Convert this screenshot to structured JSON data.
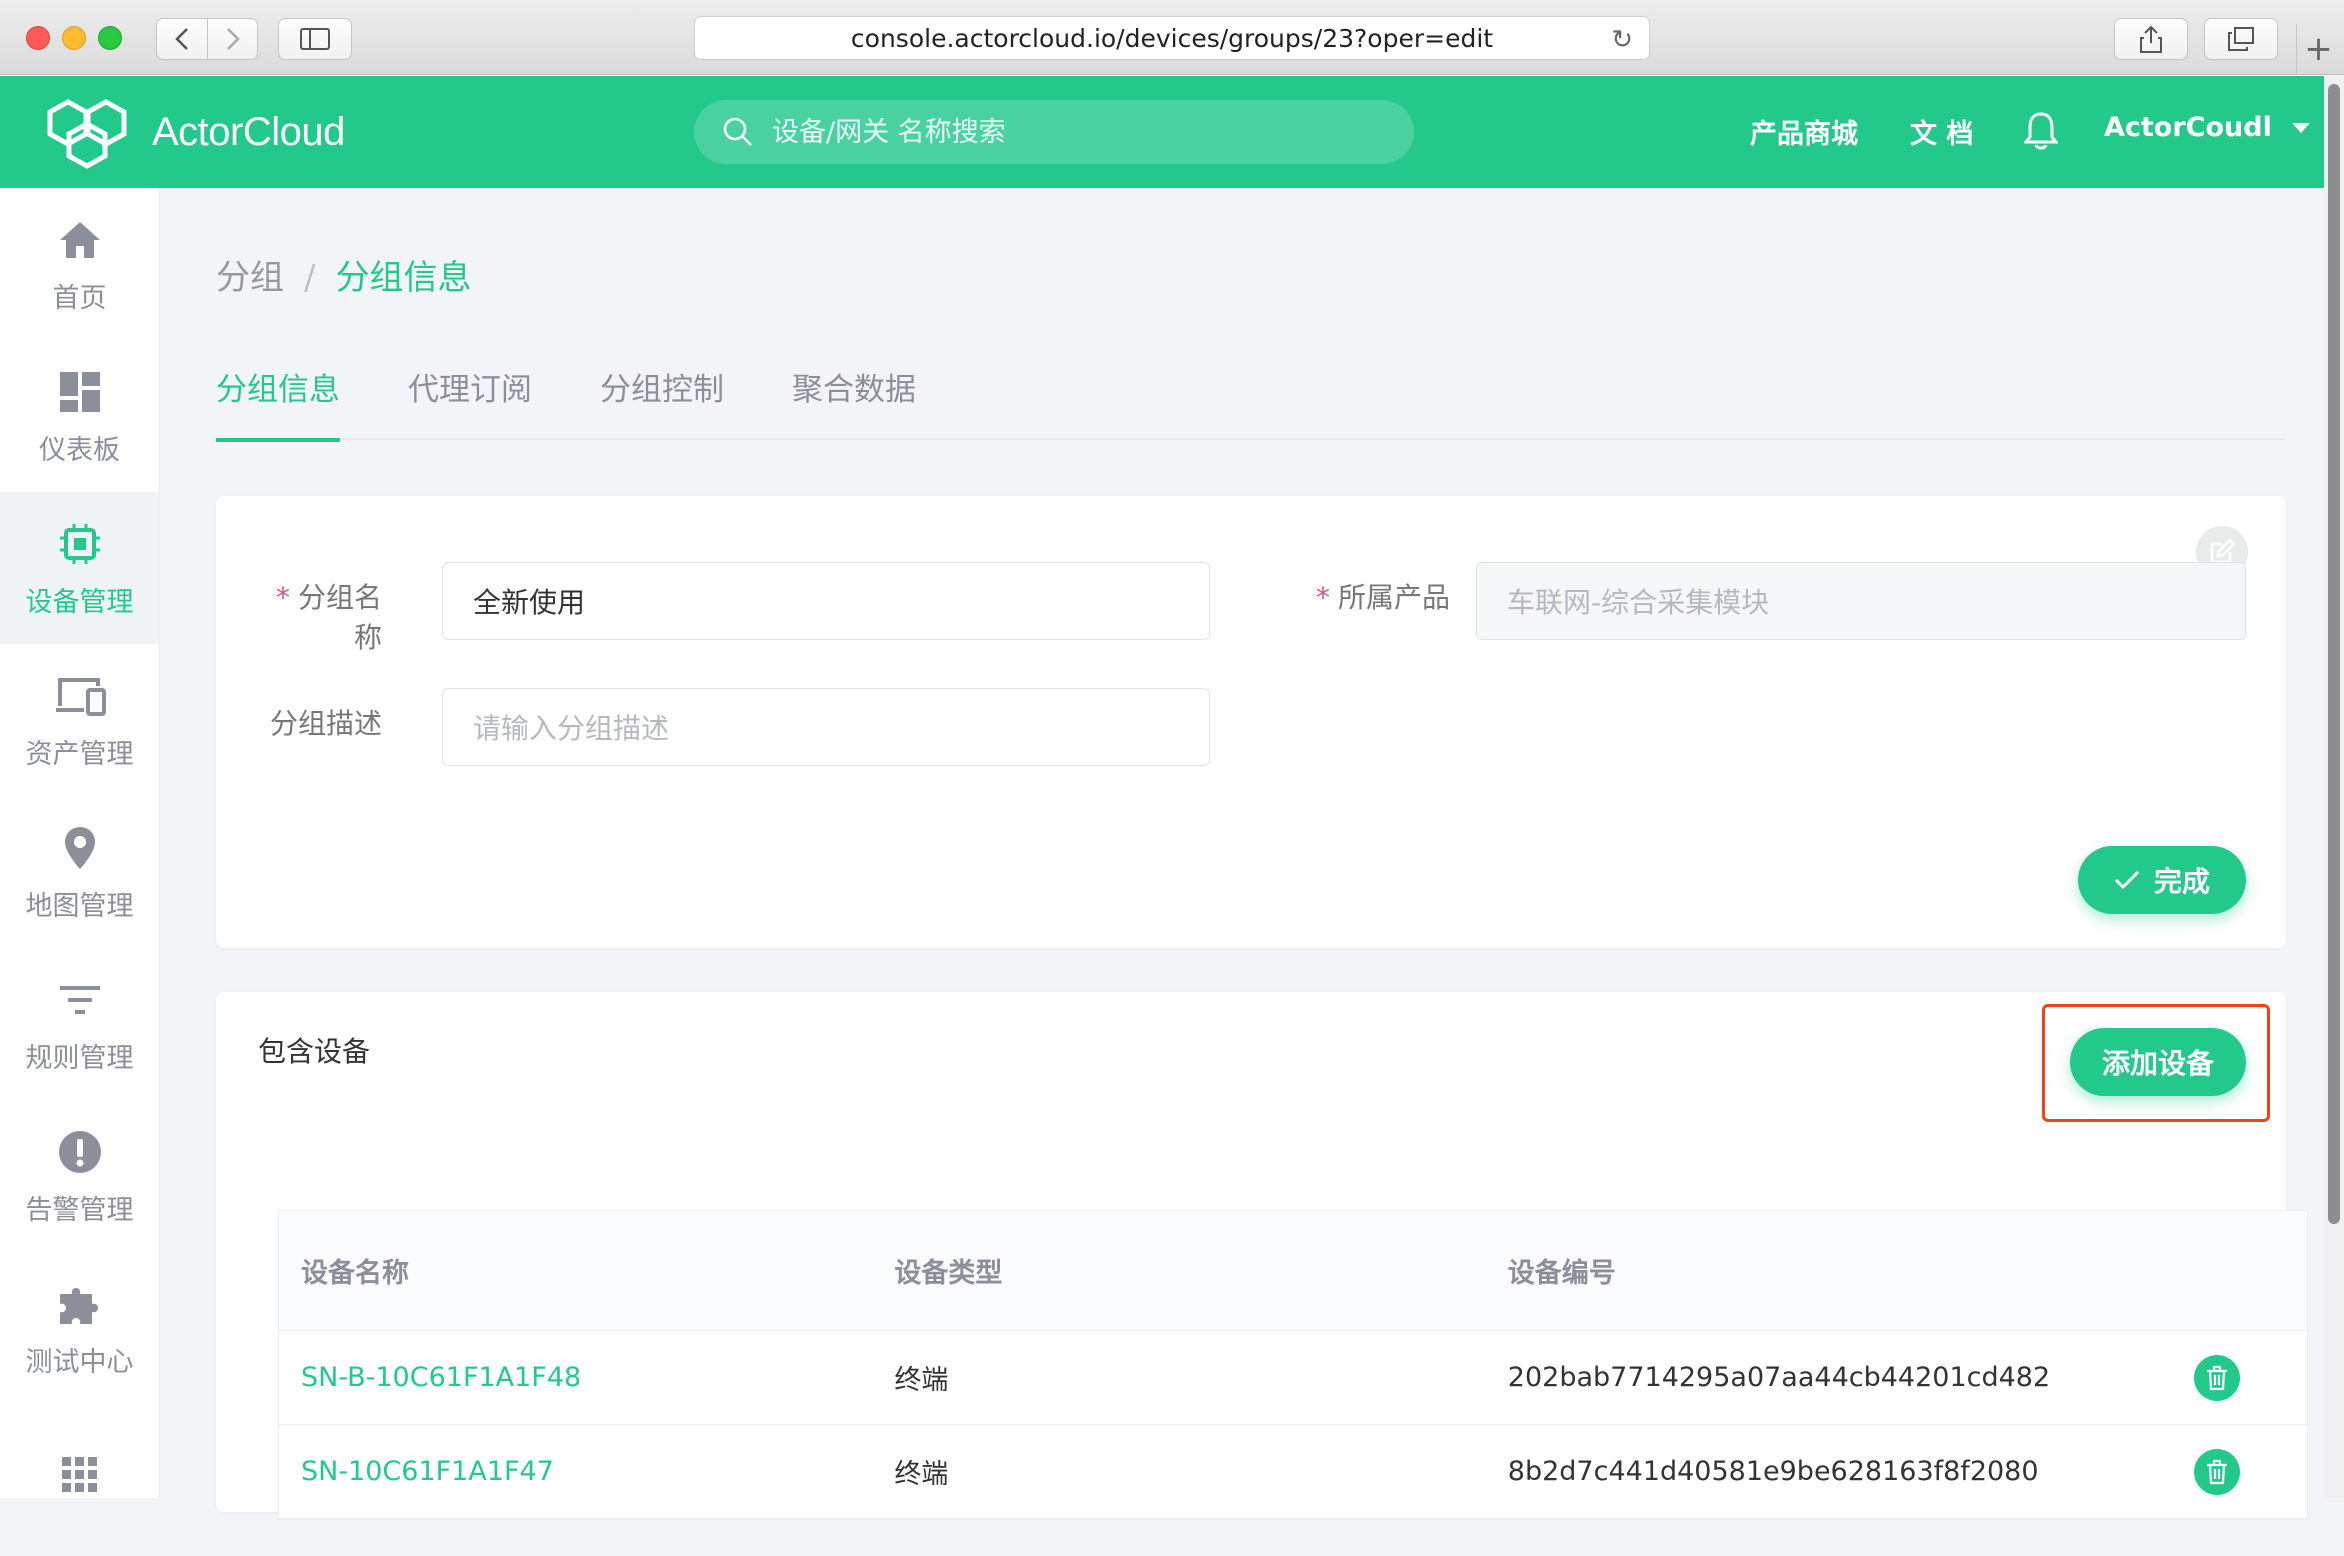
{
  "browser": {
    "url": "console.actorcloud.io/devices/groups/23?oper=edit"
  },
  "header": {
    "logo_text": "ActorCloud",
    "search_placeholder": "设备/网关 名称搜索",
    "shop_link": "产品商城",
    "docs_link": "文 档",
    "user_name": "ActorCoudl"
  },
  "sidebar": {
    "items": [
      {
        "label": "首页",
        "icon": "home-icon"
      },
      {
        "label": "仪表板",
        "icon": "dashboard-icon"
      },
      {
        "label": "设备管理",
        "icon": "chip-icon",
        "active": true
      },
      {
        "label": "资产管理",
        "icon": "devices-icon"
      },
      {
        "label": "地图管理",
        "icon": "map-pin-icon"
      },
      {
        "label": "规则管理",
        "icon": "filter-icon"
      },
      {
        "label": "告警管理",
        "icon": "alert-icon"
      },
      {
        "label": "测试中心",
        "icon": "puzzle-icon"
      },
      {
        "label": "",
        "icon": "grid-icon"
      }
    ]
  },
  "breadcrumb": {
    "parent": "分组",
    "separator": "/",
    "current": "分组信息"
  },
  "tabs": [
    {
      "label": "分组信息",
      "active": true
    },
    {
      "label": "代理订阅"
    },
    {
      "label": "分组控制"
    },
    {
      "label": "聚合数据"
    }
  ],
  "form": {
    "required_mark": "*",
    "group_name_label": "分组名称",
    "group_name_value": "全新使用",
    "product_label": "所属产品",
    "product_value": "车联网-综合采集模块",
    "description_label": "分组描述",
    "description_placeholder": "请输入分组描述",
    "done_label": "完成"
  },
  "devices": {
    "title": "包含设备",
    "add_label": "添加设备",
    "columns": [
      "设备名称",
      "设备类型",
      "设备编号"
    ],
    "rows": [
      {
        "name": "SN-B-10C61F1A1F48",
        "type": "终端",
        "id": "202bab7714295a07aa44cb44201cd482"
      },
      {
        "name": "SN-10C61F1A1F47",
        "type": "终端",
        "id": "8b2d7c441d40581e9be628163f8f2080"
      }
    ]
  },
  "colors": {
    "brand": "#22c98b",
    "highlight": "#f0431d",
    "required": "#e24b8a"
  }
}
